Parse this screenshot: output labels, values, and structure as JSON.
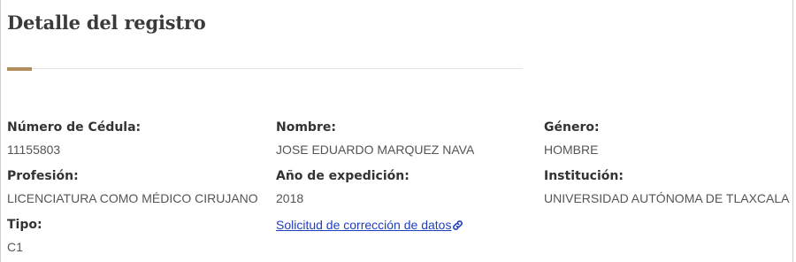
{
  "title": "Detalle del registro",
  "fields": {
    "cedula": {
      "label": "Número de Cédula:",
      "value": "11155803"
    },
    "nombre": {
      "label": "Nombre:",
      "value": "JOSE EDUARDO MARQUEZ NAVA"
    },
    "genero": {
      "label": "Género:",
      "value": "HOMBRE"
    },
    "profesion": {
      "label": "Profesión:",
      "value": "LICENCIATURA COMO MÉDICO CIRUJANO"
    },
    "anio": {
      "label": "Año de expedición:",
      "value": "2018"
    },
    "institucion": {
      "label": "Institución:",
      "value": "UNIVERSIDAD AUTÓNOMA DE TLAXCALA"
    },
    "tipo": {
      "label": "Tipo:",
      "value": "C1"
    }
  },
  "correction_link": {
    "label": "Solicitud de corrección de datos",
    "icon": "link-icon"
  },
  "colors": {
    "accent": "#b38e5d",
    "link": "#1f3fbf"
  }
}
